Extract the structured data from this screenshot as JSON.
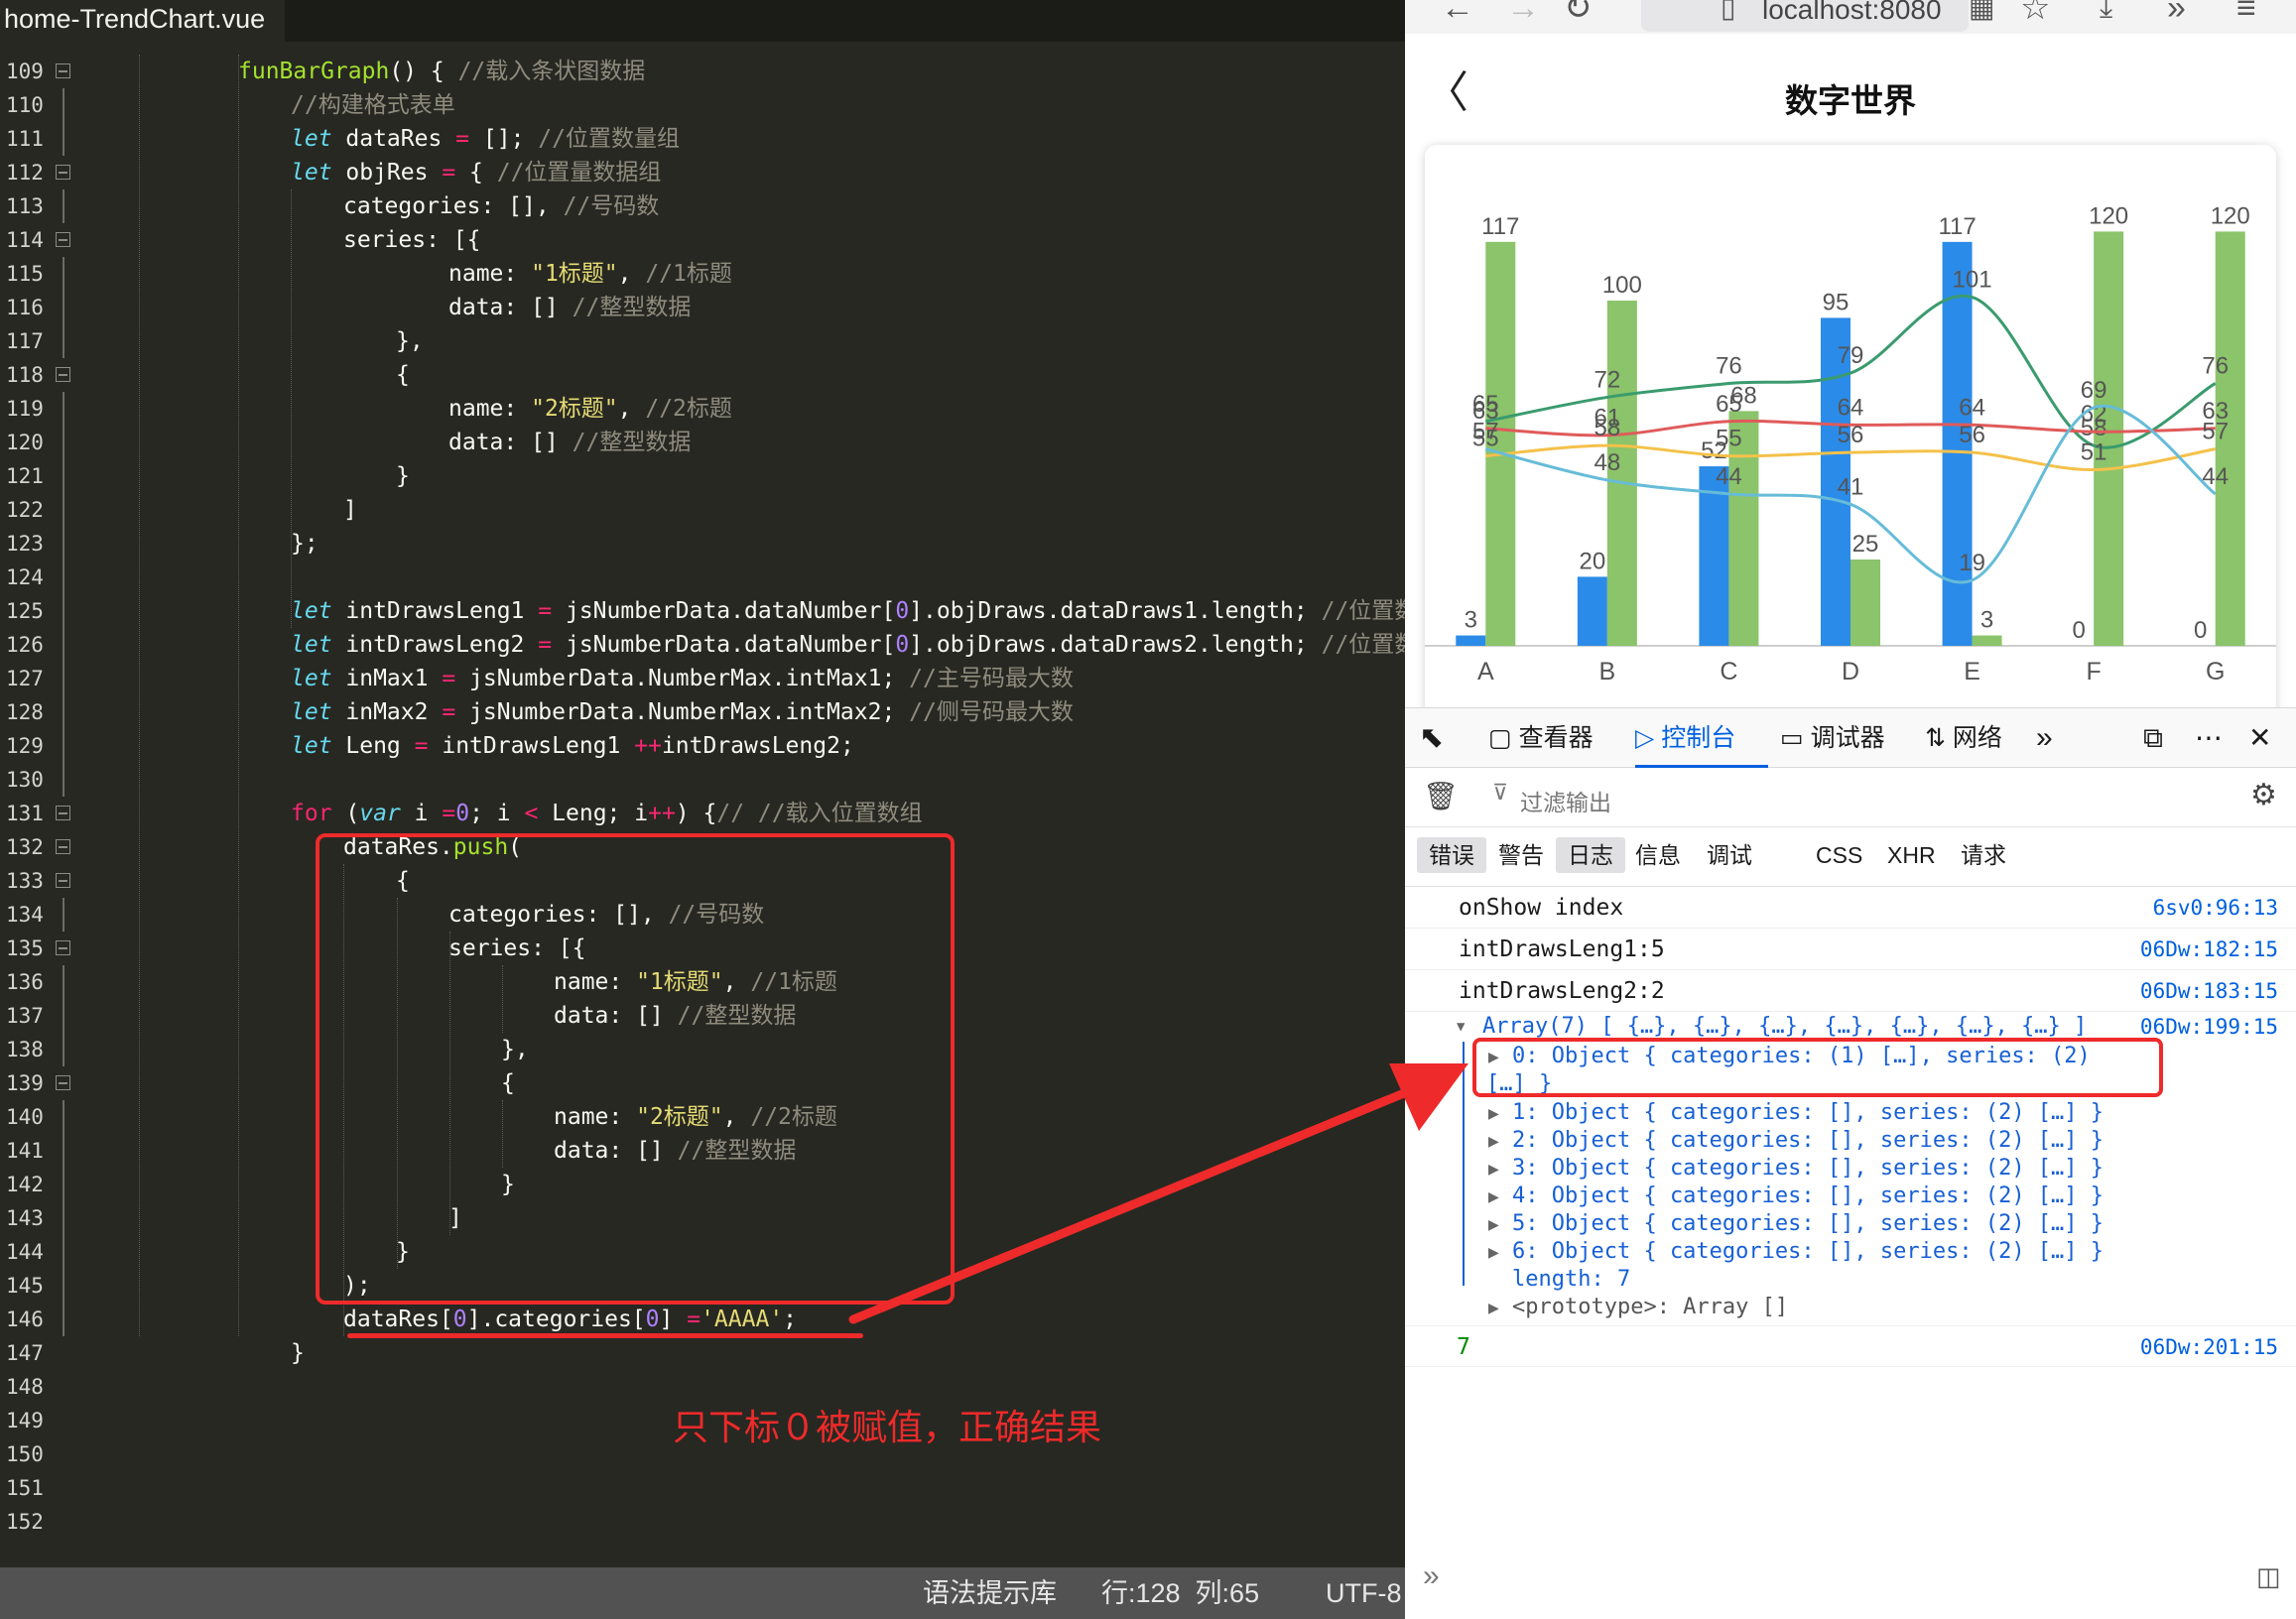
{
  "editor": {
    "file_tab": "home-TrendChart.vue",
    "lines": [
      {
        "n": "109",
        "fold": true,
        "indent": 0,
        "code": [
          [
            "fn",
            "funBarGraph"
          ],
          [
            "",
            "() { "
          ],
          [
            "cm",
            "//载入条状图数据"
          ]
        ]
      },
      {
        "n": "110",
        "fold": false,
        "indent": 1,
        "code": [
          [
            "cm",
            "//构建格式表单"
          ]
        ]
      },
      {
        "n": "111",
        "fold": false,
        "indent": 1,
        "code": [
          [
            "kw",
            "let"
          ],
          [
            "",
            " dataRes "
          ],
          [
            "op",
            "="
          ],
          [
            "",
            " []; "
          ],
          [
            "cm",
            "//位置数量组"
          ]
        ]
      },
      {
        "n": "112",
        "fold": true,
        "indent": 1,
        "code": [
          [
            "kw",
            "let"
          ],
          [
            "",
            " objRes "
          ],
          [
            "op",
            "="
          ],
          [
            "",
            " { "
          ],
          [
            "cm",
            "//位置量数据组"
          ]
        ]
      },
      {
        "n": "113",
        "fold": false,
        "indent": 2,
        "code": [
          [
            "",
            "categories: [], "
          ],
          [
            "cm",
            "//号码数"
          ]
        ]
      },
      {
        "n": "114",
        "fold": true,
        "indent": 2,
        "code": [
          [
            "",
            "series: [{"
          ]
        ]
      },
      {
        "n": "115",
        "fold": false,
        "indent": 4,
        "code": [
          [
            "",
            "name: "
          ],
          [
            "str",
            "\"1标题\""
          ],
          [
            "",
            ", "
          ],
          [
            "cm",
            "//1标题"
          ]
        ]
      },
      {
        "n": "116",
        "fold": false,
        "indent": 4,
        "code": [
          [
            "",
            "data: [] "
          ],
          [
            "cm",
            "//整型数据"
          ]
        ]
      },
      {
        "n": "117",
        "fold": false,
        "indent": 3,
        "code": [
          [
            "",
            "},"
          ]
        ]
      },
      {
        "n": "118",
        "fold": true,
        "indent": 3,
        "code": [
          [
            "",
            "{"
          ]
        ]
      },
      {
        "n": "119",
        "fold": false,
        "indent": 4,
        "code": [
          [
            "",
            "name: "
          ],
          [
            "str",
            "\"2标题\""
          ],
          [
            "",
            ", "
          ],
          [
            "cm",
            "//2标题"
          ]
        ]
      },
      {
        "n": "120",
        "fold": false,
        "indent": 4,
        "code": [
          [
            "",
            "data: [] "
          ],
          [
            "cm",
            "//整型数据"
          ]
        ]
      },
      {
        "n": "121",
        "fold": false,
        "indent": 3,
        "code": [
          [
            "",
            "}"
          ]
        ]
      },
      {
        "n": "122",
        "fold": false,
        "indent": 2,
        "code": [
          [
            "",
            "]"
          ]
        ]
      },
      {
        "n": "123",
        "fold": false,
        "indent": 1,
        "code": [
          [
            "",
            "};"
          ]
        ]
      },
      {
        "n": "124",
        "fold": false,
        "indent": 0,
        "code": []
      },
      {
        "n": "125",
        "fold": false,
        "indent": 1,
        "code": [
          [
            "kw",
            "let"
          ],
          [
            "",
            " intDrawsLeng1 "
          ],
          [
            "op",
            "="
          ],
          [
            "",
            " jsNumberData.dataNumber["
          ],
          [
            "num2",
            "0"
          ],
          [
            "",
            "].objDraws.dataDraws1.length; "
          ],
          [
            "cm",
            "//位置数量 ("
          ]
        ]
      },
      {
        "n": "126",
        "fold": false,
        "indent": 1,
        "code": [
          [
            "kw",
            "let"
          ],
          [
            "",
            " intDrawsLeng2 "
          ],
          [
            "op",
            "="
          ],
          [
            "",
            " jsNumberData.dataNumber["
          ],
          [
            "num2",
            "0"
          ],
          [
            "",
            "].objDraws.dataDraws2.length; "
          ],
          [
            "cm",
            "//位置数量 ("
          ]
        ]
      },
      {
        "n": "127",
        "fold": false,
        "indent": 1,
        "code": [
          [
            "kw",
            "let"
          ],
          [
            "",
            " inMax1 "
          ],
          [
            "op",
            "="
          ],
          [
            "",
            " jsNumberData.NumberMax.intMax1; "
          ],
          [
            "cm",
            "//主号码最大数"
          ]
        ]
      },
      {
        "n": "128",
        "fold": false,
        "indent": 1,
        "code": [
          [
            "kw",
            "let"
          ],
          [
            "",
            " inMax2 "
          ],
          [
            "op",
            "="
          ],
          [
            "",
            " jsNumberData.NumberMax.intMax2; "
          ],
          [
            "cm",
            "//侧号码最大数"
          ]
        ]
      },
      {
        "n": "129",
        "fold": false,
        "indent": 1,
        "code": [
          [
            "kw",
            "let"
          ],
          [
            "",
            " Leng "
          ],
          [
            "op",
            "="
          ],
          [
            "",
            " intDrawsLeng1 "
          ],
          [
            "op",
            "+"
          ],
          [
            " ",
            ""
          ],
          [
            "op",
            "+"
          ],
          [
            "",
            "intDrawsLeng2;"
          ]
        ]
      },
      {
        "n": "130",
        "fold": false,
        "indent": 0,
        "code": []
      },
      {
        "n": "131",
        "fold": true,
        "indent": 1,
        "code": [
          [
            "kr",
            "for"
          ],
          [
            "",
            " ("
          ],
          [
            "kw",
            "var"
          ],
          [
            "",
            " i "
          ],
          [
            "op",
            "="
          ],
          [
            " ",
            ""
          ],
          [
            "num2",
            "0"
          ],
          [
            "",
            "; i "
          ],
          [
            "op",
            "<"
          ],
          [
            "",
            " Leng; i"
          ],
          [
            "op",
            "++"
          ],
          [
            "",
            ") {"
          ],
          [
            "cm",
            "// //载入位置数组"
          ]
        ]
      },
      {
        "n": "132",
        "fold": true,
        "indent": 2,
        "code": [
          [
            "",
            "dataRes."
          ],
          [
            "fn",
            "push"
          ],
          [
            "",
            "("
          ]
        ]
      },
      {
        "n": "133",
        "fold": true,
        "indent": 3,
        "code": [
          [
            "",
            "{"
          ]
        ]
      },
      {
        "n": "134",
        "fold": false,
        "indent": 4,
        "code": [
          [
            "",
            "categories: [], "
          ],
          [
            "cm",
            "//号码数"
          ]
        ]
      },
      {
        "n": "135",
        "fold": true,
        "indent": 4,
        "code": [
          [
            "",
            "series: [{"
          ]
        ]
      },
      {
        "n": "136",
        "fold": false,
        "indent": 6,
        "code": [
          [
            "",
            "name: "
          ],
          [
            "str",
            "\"1标题\""
          ],
          [
            "",
            ", "
          ],
          [
            "cm",
            "//1标题"
          ]
        ]
      },
      {
        "n": "137",
        "fold": false,
        "indent": 6,
        "code": [
          [
            "",
            "data: [] "
          ],
          [
            "cm",
            "//整型数据"
          ]
        ]
      },
      {
        "n": "138",
        "fold": false,
        "indent": 5,
        "code": [
          [
            "",
            "},"
          ]
        ]
      },
      {
        "n": "139",
        "fold": true,
        "indent": 5,
        "code": [
          [
            "",
            "{"
          ]
        ]
      },
      {
        "n": "140",
        "fold": false,
        "indent": 6,
        "code": [
          [
            "",
            "name: "
          ],
          [
            "str",
            "\"2标题\""
          ],
          [
            "",
            ", "
          ],
          [
            "cm",
            "//2标题"
          ]
        ]
      },
      {
        "n": "141",
        "fold": false,
        "indent": 6,
        "code": [
          [
            "",
            "data: [] "
          ],
          [
            "cm",
            "//整型数据"
          ]
        ]
      },
      {
        "n": "142",
        "fold": false,
        "indent": 5,
        "code": [
          [
            "",
            "}"
          ]
        ]
      },
      {
        "n": "143",
        "fold": false,
        "indent": 4,
        "code": [
          [
            "",
            "]"
          ]
        ]
      },
      {
        "n": "144",
        "fold": false,
        "indent": 3,
        "code": [
          [
            "",
            "}"
          ]
        ]
      },
      {
        "n": "145",
        "fold": false,
        "indent": 2,
        "code": [
          [
            "",
            ");"
          ]
        ]
      },
      {
        "n": "146",
        "fold": false,
        "indent": 2,
        "code": [
          [
            "",
            "dataRes["
          ],
          [
            "num2",
            "0"
          ],
          [
            "",
            "].categories["
          ],
          [
            "num2",
            "0"
          ],
          [
            "",
            "] "
          ],
          [
            "op",
            "="
          ],
          [
            " ",
            ""
          ],
          [
            "str",
            "'AAAA'"
          ],
          [
            "",
            ";"
          ]
        ]
      },
      {
        "n": "147",
        "fold": false,
        "indent": 1,
        "code": [
          [
            "",
            "}"
          ]
        ]
      },
      {
        "n": "148",
        "fold": false,
        "indent": 0,
        "code": []
      },
      {
        "n": "149",
        "fold": false,
        "indent": 0,
        "code": []
      },
      {
        "n": "150",
        "fold": false,
        "indent": 0,
        "code": []
      },
      {
        "n": "151",
        "fold": false,
        "indent": 0,
        "code": []
      },
      {
        "n": "152",
        "fold": false,
        "indent": 0,
        "code": []
      }
    ],
    "status": {
      "syntax_lib": "语法提示库",
      "position": "行:128  列:65",
      "encoding": "UTF-8"
    }
  },
  "annotation": {
    "text": "只下标０被赋值，正确结果",
    "color": "#ee2a2a"
  },
  "browser": {
    "url": "localhost:8080",
    "app_title": "数字世界",
    "devtools": {
      "tabs": [
        {
          "id": "picker",
          "label": ""
        },
        {
          "id": "inspector",
          "label": "查看器"
        },
        {
          "id": "console",
          "label": "控制台",
          "active": true
        },
        {
          "id": "debugger",
          "label": "调试器"
        },
        {
          "id": "network",
          "label": "网络"
        }
      ],
      "filter_placeholder": "过滤输出",
      "levels": [
        {
          "label": "错误",
          "on": true
        },
        {
          "label": "警告",
          "on": false
        },
        {
          "label": "日志",
          "on": true
        },
        {
          "label": "信息",
          "on": false
        },
        {
          "label": "调试",
          "on": false
        },
        {
          "label": "CSS",
          "on": false
        },
        {
          "label": "XHR",
          "on": false
        },
        {
          "label": "请求",
          "on": false
        }
      ],
      "console_rows": [
        {
          "msg": "onShow index",
          "loc": "6sv0:96:13"
        },
        {
          "msg": "intDrawsLeng1:5",
          "loc": "06Dw:182:15"
        },
        {
          "msg": "intDrawsLeng2:2",
          "loc": "06Dw:183:15"
        }
      ],
      "array_row": {
        "msg": "Array(7) [ {…}, {…}, {…}, {…}, {…}, {…}, {…} ]",
        "loc": "06Dw:199:15"
      },
      "array_items": [
        "0: Object { categories: (1) […], series: (2)",
        "[…] }",
        "1: Object { categories: [], series: (2) […] }",
        "2: Object { categories: [], series: (2) […] }",
        "3: Object { categories: [], series: (2) […] }",
        "4: Object { categories: [], series: (2) […] }",
        "5: Object { categories: [], series: (2) […] }",
        "6: Object { categories: [], series: (2) […] }",
        "length: 7",
        "<prototype>: Array []"
      ],
      "result_row": {
        "msg": "7",
        "loc": "06Dw:201:15"
      }
    }
  },
  "chart_data": {
    "type": "bar",
    "categories": [
      "A",
      "B",
      "C",
      "D",
      "E",
      "F",
      "G"
    ],
    "ylim": [
      0,
      125
    ],
    "bar_series": [
      {
        "values": [
          3,
          20,
          52,
          95,
          117,
          0,
          0
        ],
        "color": "#2b8be8"
      },
      {
        "values": [
          117,
          100,
          68,
          25,
          3,
          120,
          120
        ],
        "color": "#8bc46a"
      }
    ],
    "line_series": [
      {
        "values": [
          65,
          72,
          76,
          79,
          101,
          58,
          76
        ],
        "color": "#3a9b6e"
      },
      {
        "values": [
          63,
          61,
          65,
          64,
          64,
          62,
          63
        ],
        "color": "#e05a5a"
      },
      {
        "values": [
          55,
          58,
          55,
          56,
          56,
          51,
          57
        ],
        "color": "#f4c14a"
      },
      {
        "values": [
          57,
          48,
          44,
          41,
          19,
          69,
          44
        ],
        "color": "#66bcd8"
      }
    ]
  }
}
